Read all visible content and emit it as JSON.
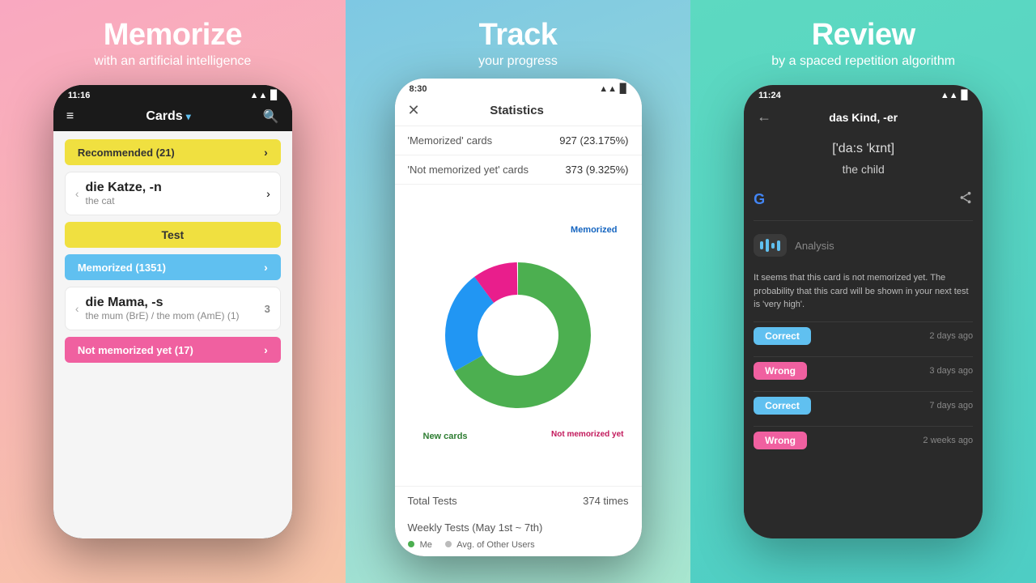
{
  "panel1": {
    "title": "Memorize",
    "subtitle": "with an artificial intelligence",
    "status_time": "11:16",
    "app_title": "Cards",
    "sections": {
      "recommended": "Recommended (21)",
      "test": "Test",
      "memorized": "Memorized (1351)",
      "not_memorized": "Not memorized yet (17)"
    },
    "card1": {
      "word": "die Katze, -n",
      "translation": "the cat"
    },
    "card2": {
      "word": "die Mama, -s",
      "translation": "the mum (BrE) / the mom (AmE) (1)"
    }
  },
  "panel2": {
    "title": "Track",
    "subtitle": "your progress",
    "status_time": "8:30",
    "screen_title": "Statistics",
    "stats": {
      "memorized_label": "'Memorized' cards",
      "memorized_value": "927 (23.175%)",
      "not_memorized_label": "'Not memorized yet' cards",
      "not_memorized_value": "373 (9.325%)",
      "total_tests_label": "Total Tests",
      "total_tests_value": "374 times",
      "weekly_tests_label": "Weekly Tests (May 1st ~ 7th)"
    },
    "chart": {
      "memorized_label": "Memorized",
      "new_cards_label": "New cards",
      "not_memorized_label": "Not memorized yet",
      "memorized_color": "#4caf50",
      "new_cards_color": "#2196f3",
      "not_memorized_color": "#e91e8c",
      "memorized_pct": 23,
      "new_cards_pct": 67,
      "not_memorized_pct": 10
    },
    "legend": {
      "me": "Me",
      "avg": "Avg. of Other Users"
    }
  },
  "panel3": {
    "title": "Review",
    "subtitle": "by a spaced repetition algorithm",
    "status_time": "11:24",
    "word_title": "das Kind, -er",
    "phonetic": "['da:s 'kɪnt]",
    "translation": "the child",
    "analysis_label": "Analysis",
    "analysis_text": "It seems that this card is not memorized yet. The probability that this card will be shown in your next test is 'very high'.",
    "results": [
      {
        "status": "Correct",
        "time": "2 days ago"
      },
      {
        "status": "Wrong",
        "time": "3 days ago"
      },
      {
        "status": "Correct",
        "time": "7 days ago"
      },
      {
        "status": "Wrong",
        "time": "2 weeks ago"
      }
    ]
  }
}
